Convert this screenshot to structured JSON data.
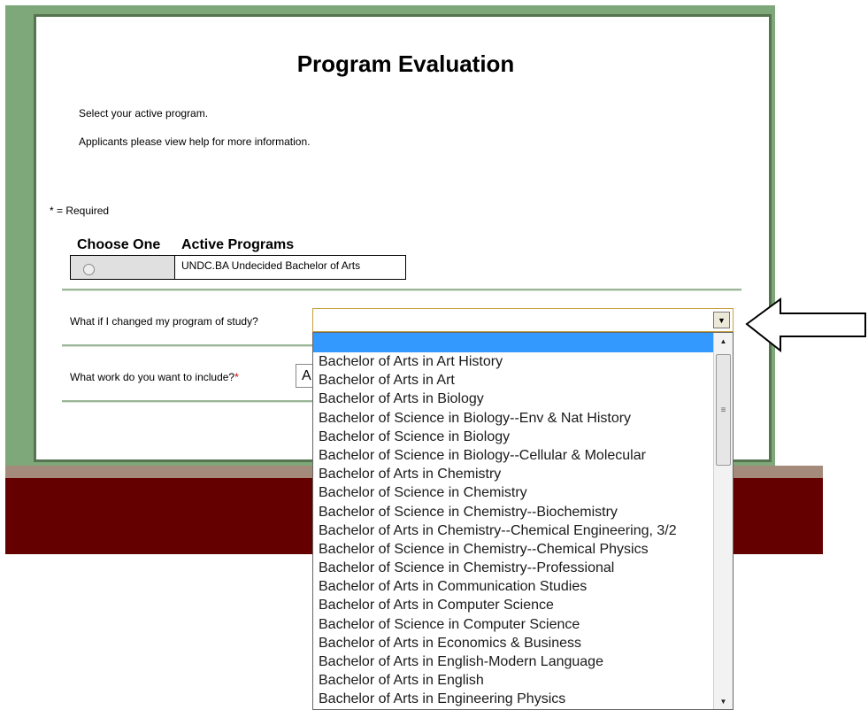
{
  "page": {
    "title": "Program Evaluation",
    "instruction_1": "Select your active program.",
    "instruction_2": "Applicants please view help for more information.",
    "required_note": "* = Required"
  },
  "programs_table": {
    "headers": [
      "Choose One",
      "Active Programs"
    ],
    "rows": [
      {
        "program": "UNDC.BA Undecided Bachelor of Arts"
      }
    ]
  },
  "what_if": {
    "label": "What if I changed my program of study?",
    "value": ""
  },
  "work_include": {
    "label": "What work do you want to include?",
    "required_mark": "*",
    "value": "A"
  },
  "dropdown": {
    "options": [
      "",
      "Bachelor of Arts in Art History",
      "Bachelor of Arts in Art",
      "Bachelor of Arts in Biology",
      "Bachelor of Science in Biology--Env & Nat History",
      "Bachelor of Science in Biology",
      "Bachelor of Science in Biology--Cellular & Molecular",
      "Bachelor of Arts in Chemistry",
      "Bachelor of Science in Chemistry",
      "Bachelor of Science in Chemistry--Biochemistry",
      "Bachelor of Arts in Chemistry--Chemical Engineering, 3/2",
      "Bachelor of Science in Chemistry--Chemical Physics",
      "Bachelor of Science in Chemistry--Professional",
      "Bachelor of Arts in Communication Studies",
      "Bachelor of Arts in Computer Science",
      "Bachelor of Science in Computer Science",
      "Bachelor of Arts in Economics & Business",
      "Bachelor of Arts in English-Modern Language",
      "Bachelor of Arts in English",
      "Bachelor of Arts in Engineering Physics"
    ]
  },
  "colors": {
    "green_frame": "#7fa87a",
    "card_border": "#56744f",
    "maroon_band": "#640000",
    "highlight": "#3399ff",
    "required_star": "#cc0000"
  },
  "icons": {
    "dropdown_arrow": "chevron-down-icon",
    "scroll_up": "scroll-up-icon",
    "scroll_down": "scroll-down-icon",
    "pointer_arrow": "left-arrow-icon"
  }
}
